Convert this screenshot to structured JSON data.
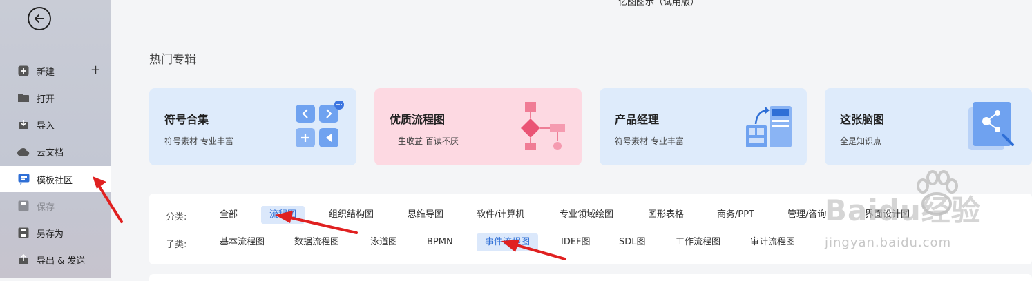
{
  "app": {
    "title": "亿图图示（试用版）"
  },
  "sidebar": {
    "items": [
      {
        "label": "新建",
        "icon": "plus-square-icon"
      },
      {
        "label": "打开",
        "icon": "folder-icon"
      },
      {
        "label": "导入",
        "icon": "import-icon"
      },
      {
        "label": "云文档",
        "icon": "cloud-icon"
      },
      {
        "label": "模板社区",
        "icon": "template-community-icon"
      },
      {
        "label": "保存",
        "icon": "save-icon"
      },
      {
        "label": "另存为",
        "icon": "save-as-icon"
      },
      {
        "label": "导出 & 发送",
        "icon": "export-icon"
      }
    ]
  },
  "hot": {
    "title": "热门专辑",
    "cards": [
      {
        "title": "符号合集",
        "subtitle": "符号素材 专业丰富",
        "bg": "#deebfb"
      },
      {
        "title": "优质流程图",
        "subtitle": "一生收益 百读不厌",
        "bg": "#fdd9e2"
      },
      {
        "title": "产品经理",
        "subtitle": "符号素材 专业丰富",
        "bg": "#deebfb"
      },
      {
        "title": "这张脑图",
        "subtitle": "全是知识点",
        "bg": "#deebfb"
      }
    ]
  },
  "filters": {
    "category_label": "分类:",
    "categories": [
      "全部",
      "流程图",
      "组织结构图",
      "思维导图",
      "软件/计算机",
      "专业领域绘图",
      "图形表格",
      "商务/PPT",
      "管理/咨询",
      "界面设计图"
    ],
    "selected_category": "流程图",
    "subcategory_label": "子类:",
    "subcategories": [
      "基本流程图",
      "数据流程图",
      "泳道图",
      "BPMN",
      "事件流程图",
      "IDEF图",
      "SDL图",
      "工作流程图",
      "审计流程图"
    ],
    "selected_subcategory": "事件流程图"
  },
  "watermark": {
    "brand": "Baidu经验",
    "url": "jingyan.baidu.com"
  },
  "colors": {
    "accent": "#2f6fd6",
    "selected_bg": "#dbe8fb",
    "annotation_arrow": "#e02020"
  }
}
